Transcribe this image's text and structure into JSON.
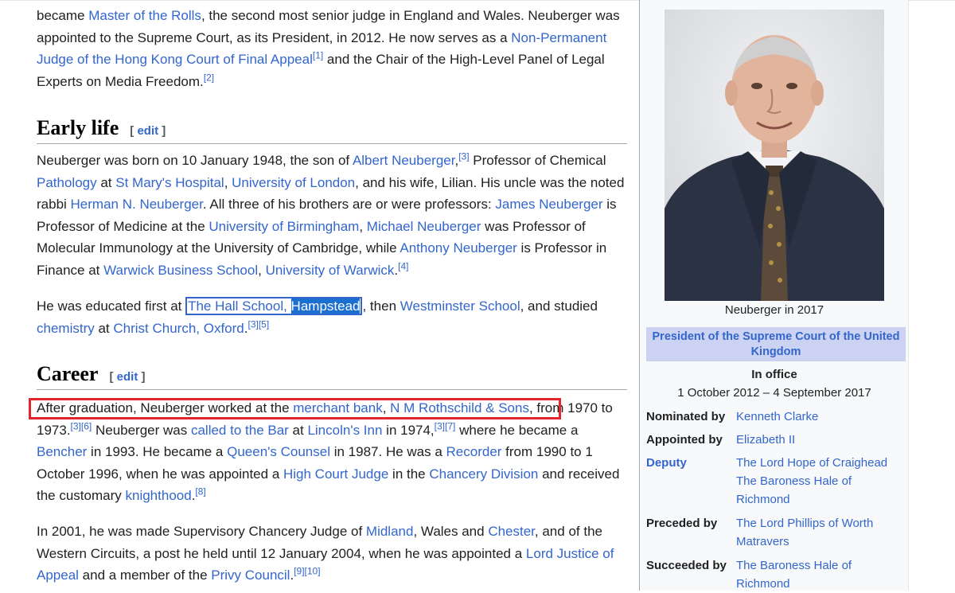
{
  "article": {
    "intro": {
      "t1": "became ",
      "l1": "Master of the Rolls",
      "t2": ", the second most senior judge in England and Wales. Neuberger was appointed to the Supreme Court, as its President, in 2012. He now serves as a ",
      "l2": "Non-Permanent Judge of the Hong Kong Court of Final Appeal",
      "r1": "[1]",
      "t3": " and the Chair of the High-Level Panel of Legal Experts on Media Freedom.",
      "r2": "[2]"
    },
    "early_life": {
      "heading": "Early life",
      "edit_open": "[ ",
      "edit": "edit",
      "edit_close": " ]",
      "p1": {
        "t1": "Neuberger was born on 10 January 1948, the son of ",
        "l1": "Albert Neuberger",
        "t1b": ",",
        "r1": "[3]",
        "t2": " Professor of Chemical ",
        "l2": "Pathology",
        "t3": " at ",
        "l3": "St Mary's Hospital",
        "t4": ", ",
        "l4": "University of London",
        "t5": ", and his wife, Lilian. His uncle was the noted rabbi ",
        "l5": "Herman N. Neuberger",
        "t6": ". All three of his brothers are or were professors: ",
        "l6": "James Neuberger",
        "t7": " is Professor of Medicine at the ",
        "l7": "University of Birmingham",
        "t8": ", ",
        "l8": "Michael Neuberger",
        "t9": " was Professor of Molecular Immunology at the University of Cambridge, while ",
        "l9": "Anthony Neuberger",
        "t10": " is Professor in Finance at ",
        "l10": "Warwick Business School",
        "t11": ", ",
        "l11": "University of Warwick",
        "t12": ".",
        "r2": "[4]"
      },
      "p2": {
        "t1": "He was educated first at ",
        "l1a": "The Hall School, ",
        "l1b": "Hampstead",
        "t2": ", then ",
        "l2": "Westminster School",
        "t3": ", and studied ",
        "l3": "chemistry",
        "t4": " at ",
        "l4": "Christ Church, Oxford",
        "t5": ".",
        "r1": "[3]",
        "r2": "[5]"
      }
    },
    "career": {
      "heading": "Career",
      "edit_open": "[ ",
      "edit": "edit",
      "edit_close": " ]",
      "p1": {
        "t1": "After graduation, Neuberger worked at the ",
        "l1": "merchant bank",
        "t2": ", ",
        "l2": "N M Rothschild & Sons",
        "t3": ", from 1970 to 1973.",
        "r1": "[3]",
        "r2": "[6]",
        "t4": " Neuberger was ",
        "l3": "called to the Bar",
        "t5": " at ",
        "l4": "Lincoln's Inn",
        "t6": " in 1974,",
        "r3": "[3]",
        "r4": "[7]",
        "t7": " where he became a ",
        "l5": "Bencher",
        "t8": " in 1993. He became a ",
        "l6": "Queen's Counsel",
        "t9": " in 1987. He was a ",
        "l7": "Recorder",
        "t10": " from 1990 to 1 October 1996, when he was appointed a ",
        "l8": "High Court Judge",
        "t11": " in the ",
        "l9": "Chancery Division",
        "t12": " and received the customary ",
        "l10": "knighthood",
        "t13": ".",
        "r5": "[8]"
      },
      "p2": {
        "t1": "In 2001, he was made Supervisory Chancery Judge of ",
        "l1": "Midland",
        "t2": ", Wales and ",
        "l2": "Chester",
        "t3": ", and of the Western Circuits, a post he held until 12 January 2004, when he was appointed a ",
        "l3": "Lord Justice of Appeal",
        "t4": " and a member of the ",
        "l4": "Privy Council",
        "t5": ".",
        "r1": "[9]",
        "r2": "[10]"
      }
    }
  },
  "infobox": {
    "caption": "Neuberger in 2017",
    "title": "President of the Supreme Court of the United Kingdom",
    "in_office": "In office",
    "dates": "1 October 2012 – 4 September 2017",
    "rows": [
      {
        "label": "Nominated by",
        "value": "Kenneth Clarke"
      },
      {
        "label": "Appointed by",
        "value": "Elizabeth II"
      },
      {
        "label": "Deputy",
        "value": "The Lord Hope of Craighead",
        "value2": "The Baroness Hale of Richmond"
      },
      {
        "label": "Preceded by",
        "value": "The Lord Phillips of Worth Matravers"
      },
      {
        "label": "Succeeded by",
        "value": "The Baroness Hale of Richmond"
      }
    ]
  },
  "colors": {
    "link": "#3366cc",
    "highlight_box": "#e3262b",
    "selection": "#1a6fd1",
    "infobox_header": "#ccd3f2"
  }
}
